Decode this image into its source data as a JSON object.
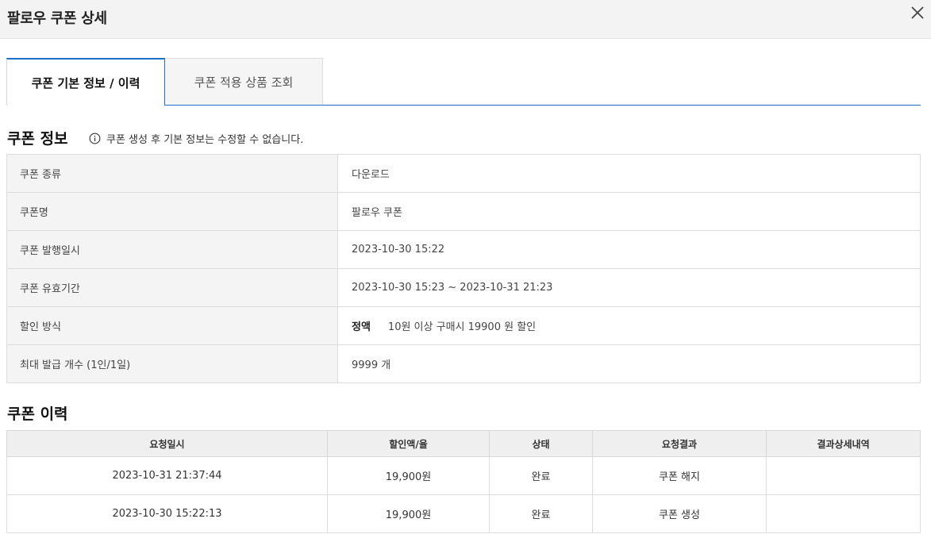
{
  "header": {
    "title": "팔로우 쿠폰 상세"
  },
  "tabs": [
    {
      "label": "쿠폰 기본 정보 / 이력",
      "active": true
    },
    {
      "label": "쿠폰 적용 상품 조회",
      "active": false
    }
  ],
  "coupon_info": {
    "title": "쿠폰 정보",
    "note": "쿠폰 생성 후 기본 정보는 수정할 수 없습니다.",
    "rows": [
      {
        "label": "쿠폰 종류",
        "value": "다운로드"
      },
      {
        "label": "쿠폰명",
        "value": "팔로우 쿠폰"
      },
      {
        "label": "쿠폰 발행일시",
        "value": "2023-10-30 15:22"
      },
      {
        "label": "쿠폰 유효기간",
        "value": "2023-10-30 15:23 ~ 2023-10-31 21:23"
      },
      {
        "label": "할인 방식",
        "type": "정액",
        "value": "10원 이상 구매시 19900 원 할인"
      },
      {
        "label": "최대 발급 개수 (1인/1일)",
        "value": "9999 개"
      }
    ]
  },
  "coupon_history": {
    "title": "쿠폰 이력",
    "columns": [
      "요청일시",
      "할인액/율",
      "상태",
      "요청결과",
      "결과상세내역"
    ],
    "rows": [
      [
        "2023-10-31  21:37:44",
        "19,900원",
        "완료",
        "쿠폰 해지",
        ""
      ],
      [
        "2023-10-30  15:22:13",
        "19,900원",
        "완료",
        "쿠폰 생성",
        ""
      ]
    ]
  }
}
